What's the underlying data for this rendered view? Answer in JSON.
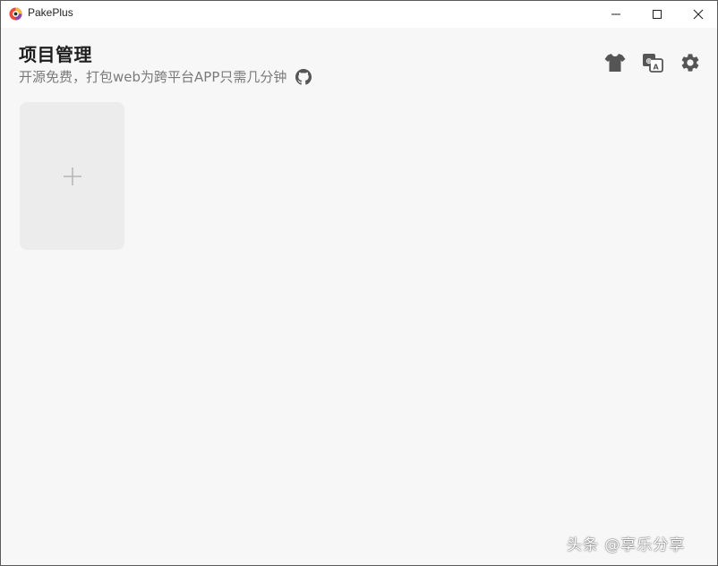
{
  "window": {
    "title": "PakePlus"
  },
  "header": {
    "title": "项目管理",
    "subtitle": "开源免费，打包web为跨平台APP只需几分钟"
  },
  "toolbar": {
    "icons": [
      "tshirt-icon",
      "translate-icon",
      "gear-icon"
    ]
  },
  "projects": {
    "add_card_icon": "plus-icon"
  },
  "watermark": {
    "text": "头条 @享乐分享"
  },
  "colors": {
    "background": "#f7f7f7",
    "card": "#ececec",
    "icon": "#555555",
    "subtitle": "#7a7a7a"
  }
}
